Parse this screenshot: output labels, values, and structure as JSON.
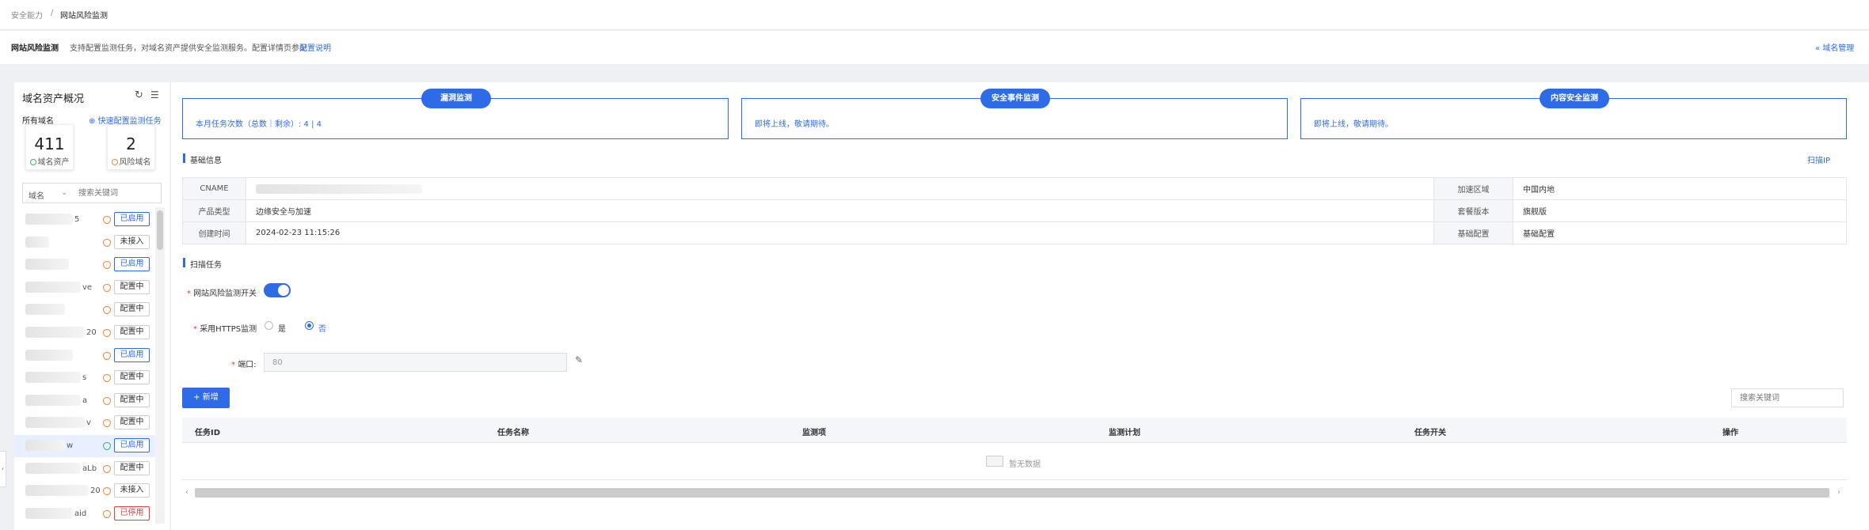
{
  "breadcrumb": {
    "parent": "安全能力",
    "sep": "/",
    "current": "网站风险监测"
  },
  "header": {
    "title": "网站风险监测",
    "desc": "支持配置监测任务，对域名资产提供安全监测服务。配置详情页参见",
    "link": "配置说明",
    "right_link": "域名管理"
  },
  "left": {
    "title": "域名资产概况",
    "all_label": "所有域名",
    "quick_link": "快速配置监测任务",
    "stats": [
      {
        "value": "411",
        "label": "域名资产"
      },
      {
        "value": "2",
        "label": "风险域名"
      }
    ],
    "filter_select": "域名",
    "search_placeholder": "搜索关键词",
    "rows": [
      {
        "text": "5",
        "status": "已启用"
      },
      {
        "text": "",
        "status": "未接入"
      },
      {
        "text": "",
        "status": "已启用"
      },
      {
        "text": "ve",
        "status": "配置中"
      },
      {
        "text": "",
        "status": "配置中"
      },
      {
        "text": "20",
        "status": "配置中"
      },
      {
        "text": "",
        "status": "已启用"
      },
      {
        "text": "s",
        "status": "配置中"
      },
      {
        "text": "a",
        "status": "配置中"
      },
      {
        "text": "v",
        "status": "配置中"
      },
      {
        "text": "w",
        "status": "已启用"
      },
      {
        "text": "aLb",
        "status": "配置中"
      },
      {
        "text": "20",
        "status": "未接入"
      },
      {
        "text": "aid",
        "status": "已停用"
      }
    ]
  },
  "cards": [
    {
      "title": "漏洞监测",
      "text": "本月任务次数（总数｜剩余）: 4 | 4"
    },
    {
      "title": "安全事件监测",
      "text": "即将上线，敬请期待。"
    },
    {
      "title": "内容安全监测",
      "text": "即将上线，敬请期待。"
    }
  ],
  "basic": {
    "title": "基础信息",
    "right_link": "扫描IP",
    "rows": [
      {
        "k1": "CNAME",
        "v1": "",
        "k2": "加速区域",
        "v2": "中国内地"
      },
      {
        "k1": "产品类型",
        "v1": "边缘安全与加速",
        "k2": "套餐版本",
        "v2": "旗舰版"
      },
      {
        "k1": "创建时间",
        "v1": "2024-02-23 11:15:26",
        "k2": "基础配置",
        "v2": "基础配置"
      }
    ]
  },
  "scan": {
    "title": "扫描任务",
    "switch_label": "网站风险监测开关",
    "https_label": "采用HTTPS监测",
    "opt_yes": "是",
    "opt_no": "否",
    "port_label": "端口:",
    "port_value": "80",
    "add_button": "新增",
    "search_placeholder": "搜索关键词",
    "columns": [
      "任务ID",
      "任务名称",
      "监测项",
      "监测计划",
      "任务开关",
      "操作"
    ],
    "empty": "暂无数据"
  },
  "colors": {
    "accent": "#2e6be6",
    "danger": "#e04040",
    "warn": "#f0883e",
    "ok": "#3cb371"
  }
}
